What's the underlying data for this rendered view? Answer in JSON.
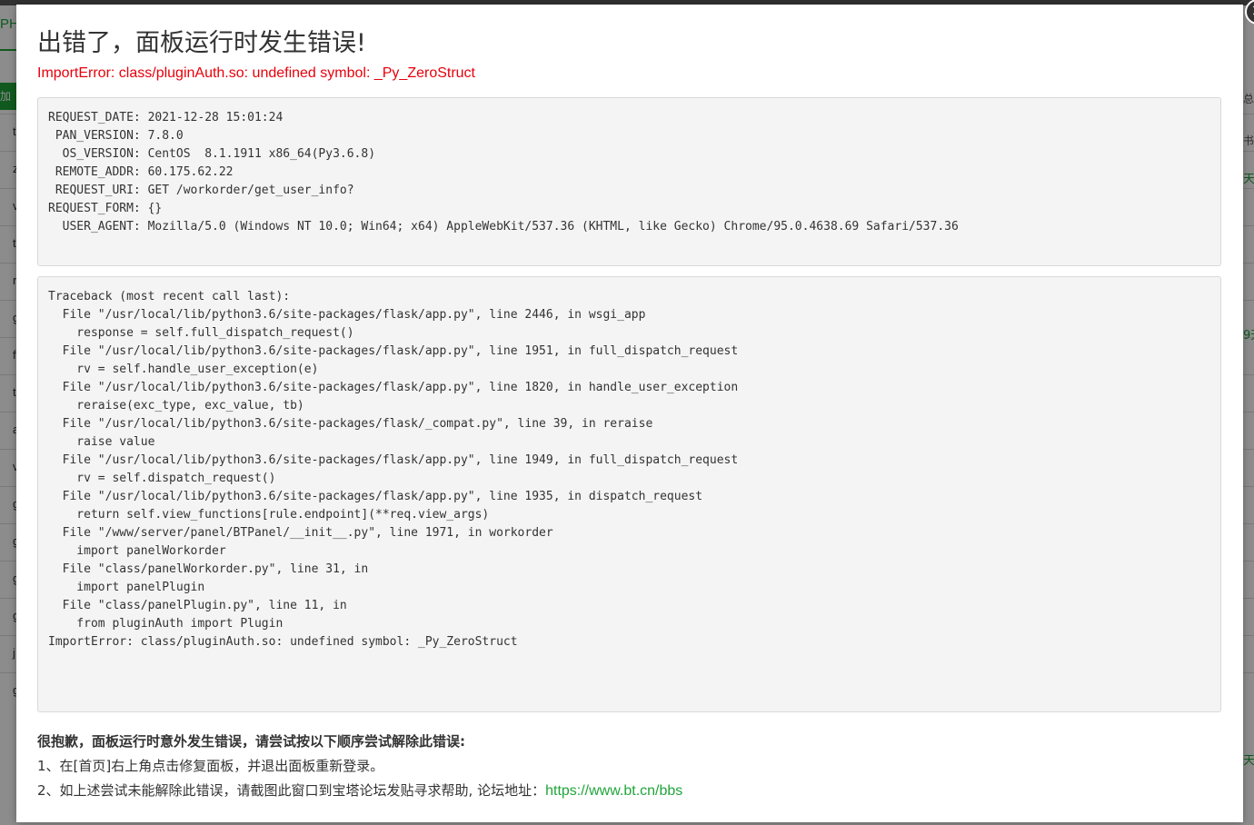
{
  "background": {
    "tab_label": "PH",
    "add_button_label": "加站",
    "left_letters": [
      "t",
      "z",
      "v",
      "t",
      "r",
      "g",
      "f",
      "t",
      "a",
      "v",
      "g",
      "g",
      "g",
      "g",
      "j",
      "g"
    ],
    "right_texts": [
      {
        "text": "总",
        "color": "#555555"
      },
      {
        "text": "书",
        "color": "#555555"
      },
      {
        "text": "天",
        "color": "#20a53a"
      },
      {
        "text": "9天",
        "color": "#20a53a"
      },
      {
        "text": "天",
        "color": "#20a53a"
      }
    ]
  },
  "modal": {
    "close_label": "×",
    "title": "出错了，面板运行时发生错误!",
    "error_summary": "ImportError: class/pluginAuth.so: undefined symbol: _Py_ZeroStruct",
    "request_info": [
      {
        "key": "REQUEST_DATE",
        "value": "2021-12-28 15:01:24"
      },
      {
        "key": " PAN_VERSION",
        "value": "7.8.0"
      },
      {
        "key": "  OS_VERSION",
        "value": "CentOS  8.1.1911 x86_64(Py3.6.8)"
      },
      {
        "key": " REMOTE_ADDR",
        "value": "60.175.62.22"
      },
      {
        "key": " REQUEST_URI",
        "value": "GET /workorder/get_user_info?"
      },
      {
        "key": "REQUEST_FORM",
        "value": "{}"
      },
      {
        "key": "  USER_AGENT",
        "value": "Mozilla/5.0 (Windows NT 10.0; Win64; x64) AppleWebKit/537.36 (KHTML, like Gecko) Chrome/95.0.4638.69 Safari/537.36"
      }
    ],
    "traceback": [
      "Traceback (most recent call last):",
      "  File \"/usr/local/lib/python3.6/site-packages/flask/app.py\", line 2446, in wsgi_app",
      "    response = self.full_dispatch_request()",
      "  File \"/usr/local/lib/python3.6/site-packages/flask/app.py\", line 1951, in full_dispatch_request",
      "    rv = self.handle_user_exception(e)",
      "  File \"/usr/local/lib/python3.6/site-packages/flask/app.py\", line 1820, in handle_user_exception",
      "    reraise(exc_type, exc_value, tb)",
      "  File \"/usr/local/lib/python3.6/site-packages/flask/_compat.py\", line 39, in reraise",
      "    raise value",
      "  File \"/usr/local/lib/python3.6/site-packages/flask/app.py\", line 1949, in full_dispatch_request",
      "    rv = self.dispatch_request()",
      "  File \"/usr/local/lib/python3.6/site-packages/flask/app.py\", line 1935, in dispatch_request",
      "    return self.view_functions[rule.endpoint](**req.view_args)",
      "  File \"/www/server/panel/BTPanel/__init__.py\", line 1971, in workorder",
      "    import panelWorkorder",
      "  File \"class/panelWorkorder.py\", line 31, in",
      "    import panelPlugin",
      "  File \"class/panelPlugin.py\", line 11, in",
      "    from pluginAuth import Plugin",
      "ImportError: class/pluginAuth.so: undefined symbol: _Py_ZeroStruct"
    ],
    "help": {
      "heading": "很抱歉，面板运行时意外发生错误，请尝试按以下顺序尝试解除此错误:",
      "line1": "1、在[首页]右上角点击修复面板，并退出面板重新登录。",
      "line2_prefix": "2、如上述尝试未能解除此错误，请截图此窗口到宝塔论坛发贴寻求帮助, 论坛地址：",
      "forum_link": "https://www.bt.cn/bbs"
    }
  },
  "colors": {
    "brand_green": "#20a53a",
    "error_red": "#e8000b"
  }
}
